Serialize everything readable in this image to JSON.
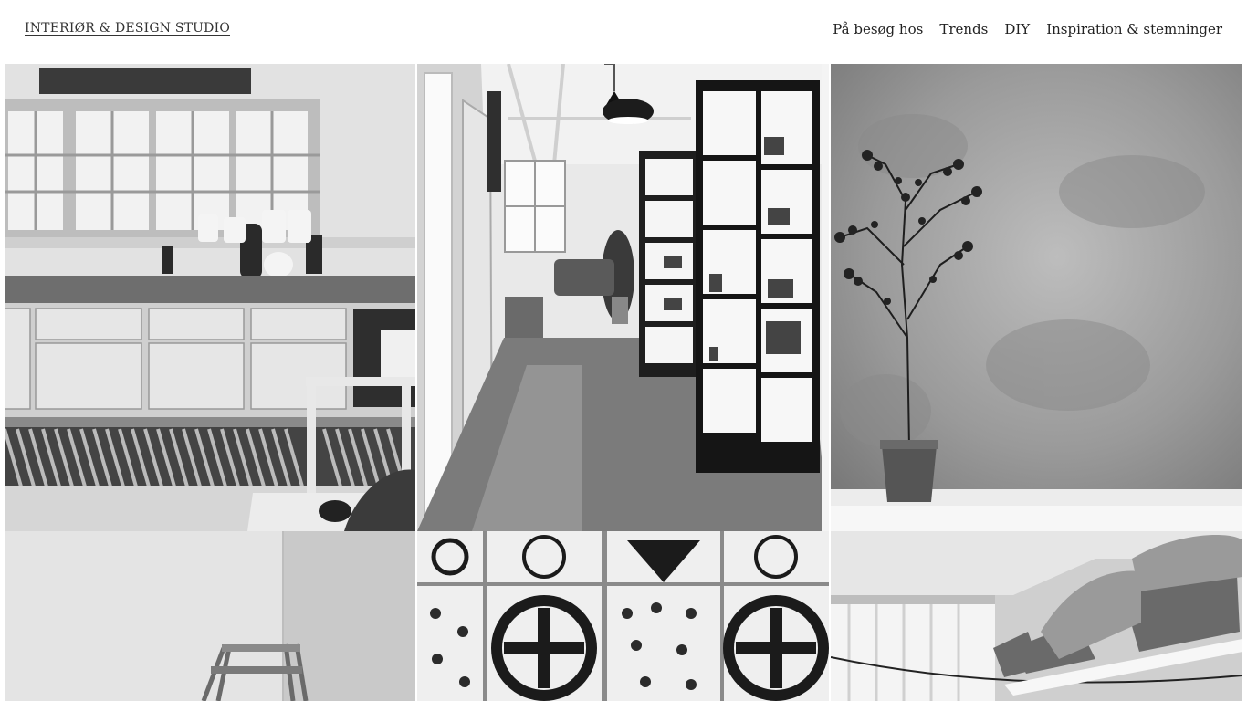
{
  "header": {
    "logo": "INTERIØR & DESIGN STUDIO",
    "nav": [
      {
        "label": "På besøg hos"
      },
      {
        "label": "Trends"
      },
      {
        "label": "DIY"
      },
      {
        "label": "Inspiration & stemninger"
      }
    ]
  },
  "gallery": {
    "tiles": [
      {
        "subject": "kitchen-photo"
      },
      {
        "subject": "hallway-display-cabinets-photo"
      },
      {
        "subject": "olive-tree-plaster-wall-photo"
      },
      {
        "subject": "painting-ladder-photo"
      },
      {
        "subject": "patterned-tiles-photo"
      },
      {
        "subject": "laundry-baskets-photo"
      }
    ]
  }
}
